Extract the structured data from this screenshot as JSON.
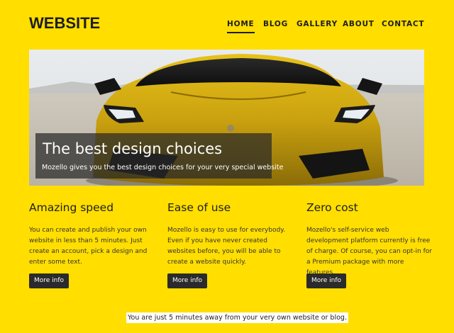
{
  "header": {
    "logo": "WEBSITE",
    "nav": [
      {
        "label": "HOME",
        "active": true
      },
      {
        "label": "BLOG",
        "active": false
      },
      {
        "label": "GALLERY",
        "active": false
      },
      {
        "label": "ABOUT",
        "active": false
      },
      {
        "label": "CONTACT",
        "active": false
      }
    ]
  },
  "hero": {
    "title": "The best design choices",
    "subtitle": "Mozello gives you the best design choices for your very special website",
    "image_subject": "yellow sports car"
  },
  "features": [
    {
      "title": "Amazing speed",
      "text": "You can create and publish your own website in less than 5 minutes. Just create an account, pick a design and enter some text.",
      "button": "More info"
    },
    {
      "title": "Ease of use",
      "text": "Mozello is easy to use for everybody. Even if you have never created websites before, you will be able to create a website quickly.",
      "button": "More info"
    },
    {
      "title": "Zero cost",
      "text": "Mozello's self-service web development platform currently is free of charge. Of course, you can opt-in for a Premium package with more features.",
      "button": "More info"
    }
  ],
  "footer": {
    "note": "You are just 5 minutes away from your very own website or blog."
  },
  "colors": {
    "background": "#ffde00",
    "text": "#1e1e1e",
    "button": "#2b2b2b"
  }
}
